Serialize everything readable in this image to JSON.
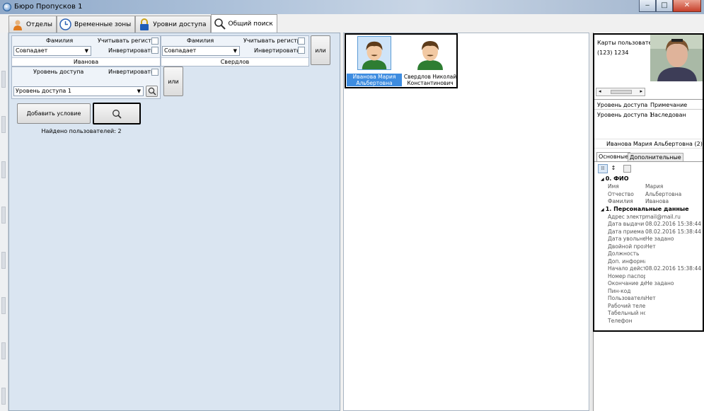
{
  "window": {
    "title": "Бюро Пропусков 1",
    "controls": {
      "minimize": "‒",
      "maximize": "□",
      "close": "✕"
    }
  },
  "tabs": [
    {
      "label": "Отделы",
      "icon": "person-icon"
    },
    {
      "label": "Временные зоны",
      "icon": "clock-icon"
    },
    {
      "label": "Уровни доступа",
      "icon": "lock-icon"
    },
    {
      "label": "Общий поиск",
      "icon": "search-icon",
      "active": true
    }
  ],
  "conditions": {
    "surname1": {
      "field": "Фамилия",
      "case_label": "Учитывать регистр",
      "invert_label": "Инвертировать",
      "match": "Совпадает",
      "value": "Иванова"
    },
    "surname2": {
      "field": "Фамилия",
      "case_label": "Учитывать регистр",
      "invert_label": "Инвертировать",
      "match": "Совпадает",
      "value": "Свердлов"
    },
    "access": {
      "field": "Уровень доступа",
      "invert_label": "Инвертировать",
      "value": "Уровень доступа 1"
    },
    "or1": "или",
    "or2": "или"
  },
  "actions": {
    "add_condition": "Добавить условие",
    "found": "Найдено пользователей: 2"
  },
  "users": [
    {
      "name_line1": "Иванова Мария",
      "name_line2": "Альбертовна",
      "selected": true
    },
    {
      "name_line1": "Свердлов Николай",
      "name_line2": "Константинович",
      "selected": false
    }
  ],
  "right": {
    "cards_label": "Карты пользовате",
    "card_number": "(123) 1234",
    "table_headers": [
      "Уровень доступа",
      "Примечание"
    ],
    "table_rows": [
      [
        "Уровень доступа 1",
        "Наследован"
      ]
    ],
    "user_caption": "Иванова Мария Альбертовна (2)",
    "tabs": [
      "Основные",
      "Дополнительные"
    ],
    "sections": [
      {
        "title": "0. ФИО",
        "rows": [
          [
            "Имя",
            "Мария"
          ],
          [
            "Отчество",
            "Альбертовна"
          ],
          [
            "Фамилия",
            "Иванова"
          ]
        ]
      },
      {
        "title": "1. Персональные данные",
        "rows": [
          [
            "Адрес электр.",
            "mail@mail.ru"
          ],
          [
            "Дата выдачи ка",
            "08.02.2016 15:38:44"
          ],
          [
            "Дата приема на",
            "08.02.2016 15:38:44"
          ],
          [
            "Дата увольнени",
            "Не задано"
          ],
          [
            "Двойной прохо",
            "Нет"
          ],
          [
            "Должность",
            ""
          ],
          [
            "Доп. информац",
            ""
          ],
          [
            "Начало действ",
            "08.02.2016 15:38:44"
          ],
          [
            "Номер паспорт",
            ""
          ],
          [
            "Окончание дей",
            "Не задано"
          ],
          [
            "Пин-код",
            ""
          ],
          [
            "Пользователь",
            "Нет"
          ],
          [
            "Рабочий телеф",
            ""
          ],
          [
            "Табельный ном",
            ""
          ],
          [
            "Телефон",
            ""
          ]
        ]
      }
    ]
  }
}
